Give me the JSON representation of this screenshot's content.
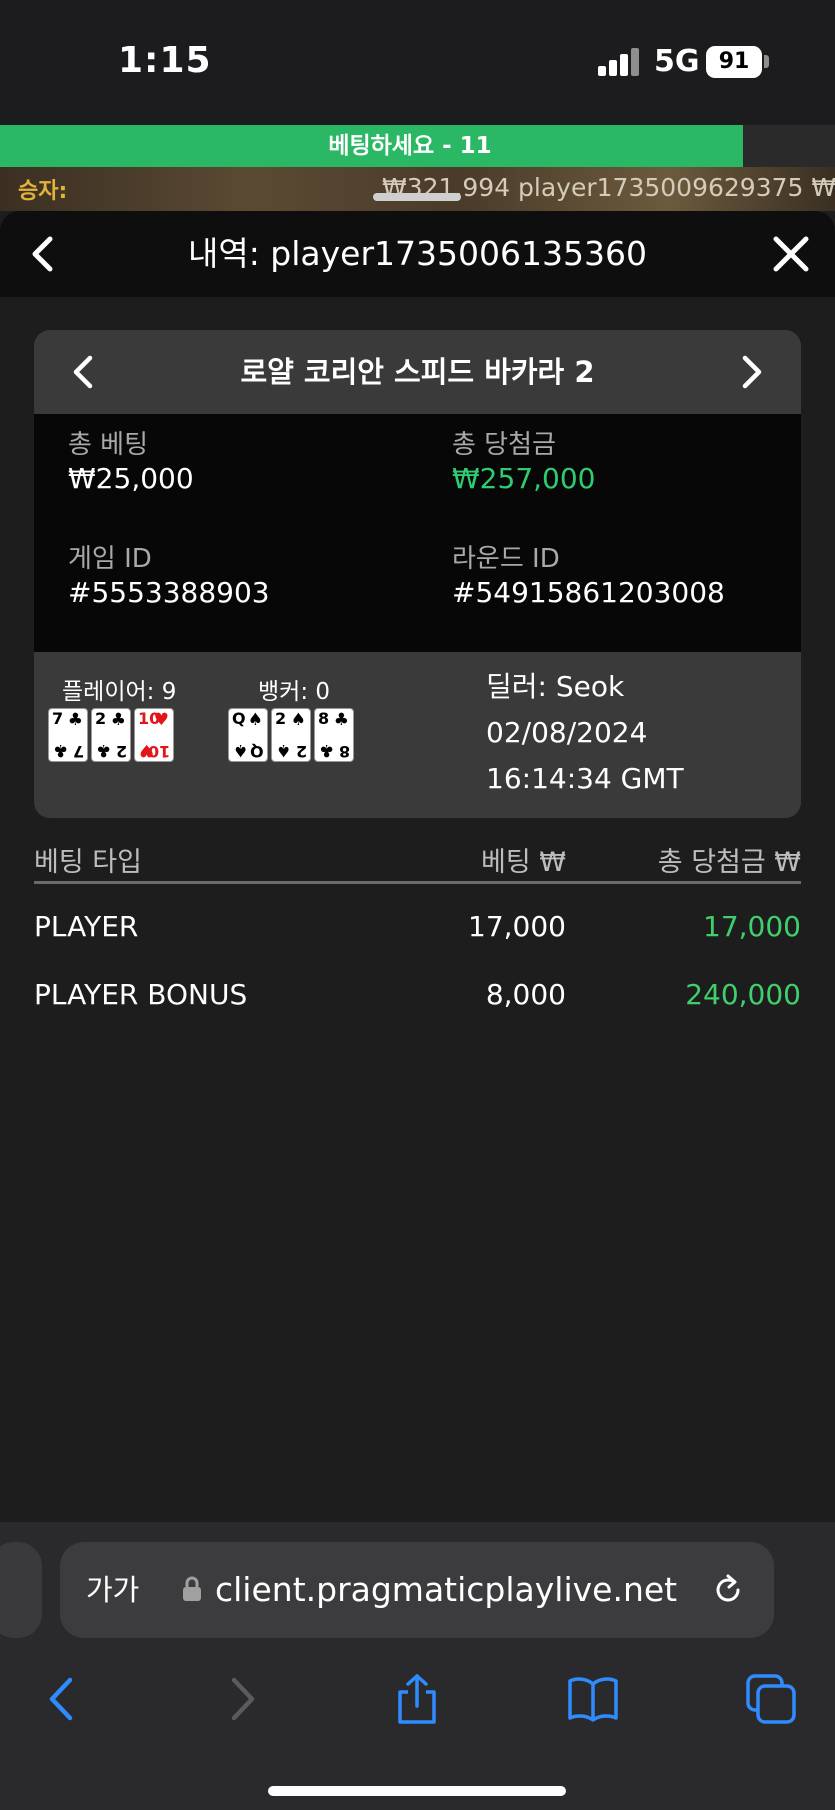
{
  "status_bar": {
    "time": "1:15",
    "network": "5G",
    "battery": "91"
  },
  "game_bar": {
    "bet_prompt": "베팅하세요 - 11",
    "timer_progress": 0.89,
    "winners_label": "승자:",
    "winners_ticker": "₩321,994 player1735009629375   ₩"
  },
  "history": {
    "title": "내역: player1735006135360"
  },
  "game_card": {
    "game_name": "로얄 코리안 스피드 바카라 2",
    "total_bet_label": "총 베팅",
    "total_bet_value": "₩25,000",
    "total_win_label": "총 당첨금",
    "total_win_value": "₩257,000",
    "game_id_label": "게임 ID",
    "game_id_value": "#5553388903",
    "round_id_label": "라운드 ID",
    "round_id_value": "#54915861203008",
    "player_label": "플레이어: 9",
    "banker_label": "뱅커: 0",
    "player_cards": [
      {
        "rank": "7",
        "suit": "♣",
        "color": "#000000"
      },
      {
        "rank": "2",
        "suit": "♣",
        "color": "#000000"
      },
      {
        "rank": "10",
        "suit": "♥",
        "color": "#e3151a"
      }
    ],
    "banker_cards": [
      {
        "rank": "Q",
        "suit": "♠",
        "color": "#000000"
      },
      {
        "rank": "2",
        "suit": "♠",
        "color": "#000000"
      },
      {
        "rank": "8",
        "suit": "♣",
        "color": "#000000"
      }
    ],
    "dealer": "딜러: Seok",
    "date": "02/08/2024",
    "time": "16:14:34 GMT"
  },
  "bets": {
    "headers": {
      "type": "베팅 타입",
      "bet": "베팅 ₩",
      "win": "총 당첨금 ₩"
    },
    "rows": [
      {
        "type": "PLAYER",
        "bet": "17,000",
        "win": "17,000"
      },
      {
        "type": "PLAYER BONUS",
        "bet": "8,000",
        "win": "240,000"
      }
    ]
  },
  "browser": {
    "text_size_button": "가가",
    "url": "client.pragmaticplaylive.net"
  },
  "colors": {
    "accent_green": "#2bb865",
    "win_green": "#2ecc71",
    "link_blue": "#2f8cff"
  }
}
